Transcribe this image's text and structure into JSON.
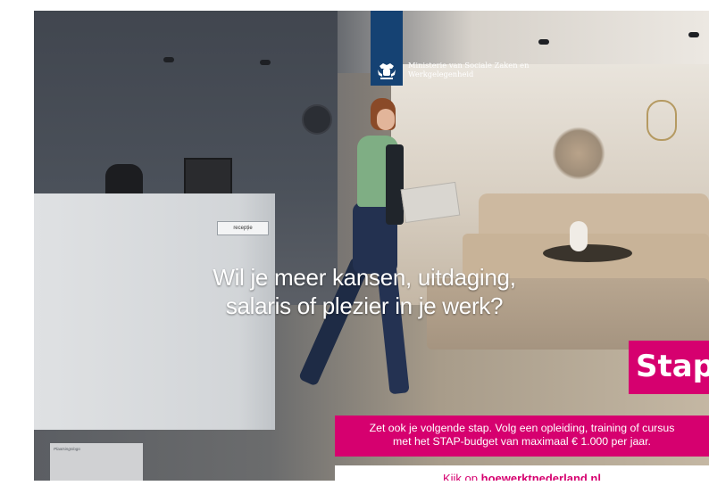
{
  "ministry": {
    "line1": "Ministerie van Sociale Zaken en",
    "line2": "Werkgelegenheid",
    "logo_color": "#154273",
    "emblem_icon": "coat-of-arms-icon"
  },
  "scene": {
    "desk_sign": "recepție"
  },
  "headline": {
    "line1": "Wil je meer kansen, uitdaging,",
    "line2": "salaris of plezier in je werk?"
  },
  "brand": {
    "logo_text": "Stap",
    "color": "#d6006f"
  },
  "info": {
    "line1": "Zet ook je volgende stap. Volg een opleiding, training of cursus",
    "line2": "met het STAP-budget van maximaal € 1.000 per jaar."
  },
  "cta": {
    "prefix": "Kijk op ",
    "url": "hoewerktnederland.nl"
  },
  "paste_area": {
    "label": "Plaatsingslogo"
  }
}
